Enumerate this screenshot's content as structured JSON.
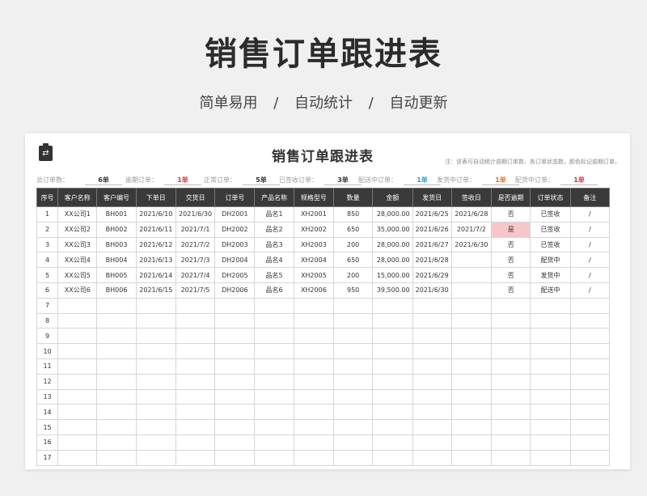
{
  "page": {
    "title": "销售订单跟进表",
    "subtitle_items": [
      "简单易用",
      "自动统计",
      "自动更新"
    ],
    "subtitle_sep": "/"
  },
  "sheet": {
    "title": "销售订单跟进表",
    "note": "注：该表可自动统计逾期订单数、各订单状态数，颜色标记逾期订单。",
    "summary": [
      {
        "label": "总订单数：",
        "value": "6单",
        "color": "#333333"
      },
      {
        "label": "逾期订单：",
        "value": "1单",
        "color": "#e0303a"
      },
      {
        "label": "正常订单：",
        "value": "5单",
        "color": "#333333"
      },
      {
        "label": "已签收订单：",
        "value": "3单",
        "color": "#333333"
      },
      {
        "label": "配送中订单：",
        "value": "1单",
        "color": "#2a9fd6"
      },
      {
        "label": "发货中订单：",
        "value": "1单",
        "color": "#e8712c"
      },
      {
        "label": "配货中订单：",
        "value": "1单",
        "color": "#e0303a"
      }
    ],
    "columns": [
      "序号",
      "客户名称",
      "客户编号",
      "下单日",
      "交货日",
      "订单号",
      "产品名称",
      "规格型号",
      "数量",
      "金额",
      "发货日",
      "签收日",
      "是否逾期",
      "订单状态",
      "备注"
    ],
    "rows": [
      [
        "1",
        "XX公司1",
        "BH001",
        "2021/6/10",
        "2021/6/30",
        "DH2001",
        "品名1",
        "XH2001",
        "850",
        "28,000.00",
        "2021/6/25",
        "2021/6/28",
        "否",
        "已签收",
        "/"
      ],
      [
        "2",
        "XX公司2",
        "BH002",
        "2021/6/11",
        "2021/7/1",
        "DH2002",
        "品名2",
        "XH2002",
        "650",
        "35,000.00",
        "2021/6/26",
        "2021/7/2",
        "是",
        "已签收",
        "/"
      ],
      [
        "3",
        "XX公司3",
        "BH003",
        "2021/6/12",
        "2021/7/2",
        "DH2003",
        "品名3",
        "XH2003",
        "200",
        "28,000.00",
        "2021/6/27",
        "2021/6/30",
        "否",
        "已签收",
        "/"
      ],
      [
        "4",
        "XX公司4",
        "BH004",
        "2021/6/13",
        "2021/7/3",
        "DH2004",
        "品名4",
        "XH2004",
        "650",
        "28,000.00",
        "2021/6/28",
        "",
        "否",
        "配货中",
        "/"
      ],
      [
        "5",
        "XX公司5",
        "BH005",
        "2021/6/14",
        "2021/7/4",
        "DH2005",
        "品名5",
        "XH2005",
        "200",
        "15,000.00",
        "2021/6/29",
        "",
        "否",
        "发货中",
        "/"
      ],
      [
        "6",
        "XX公司6",
        "BH006",
        "2021/6/15",
        "2021/7/5",
        "DH2006",
        "品名6",
        "XH2006",
        "950",
        "39,500.00",
        "2021/6/30",
        "",
        "否",
        "配送中",
        "/"
      ]
    ],
    "empty_row_numbers": [
      "7",
      "8",
      "9",
      "10",
      "11",
      "12",
      "13",
      "14",
      "15",
      "16",
      "17"
    ]
  }
}
